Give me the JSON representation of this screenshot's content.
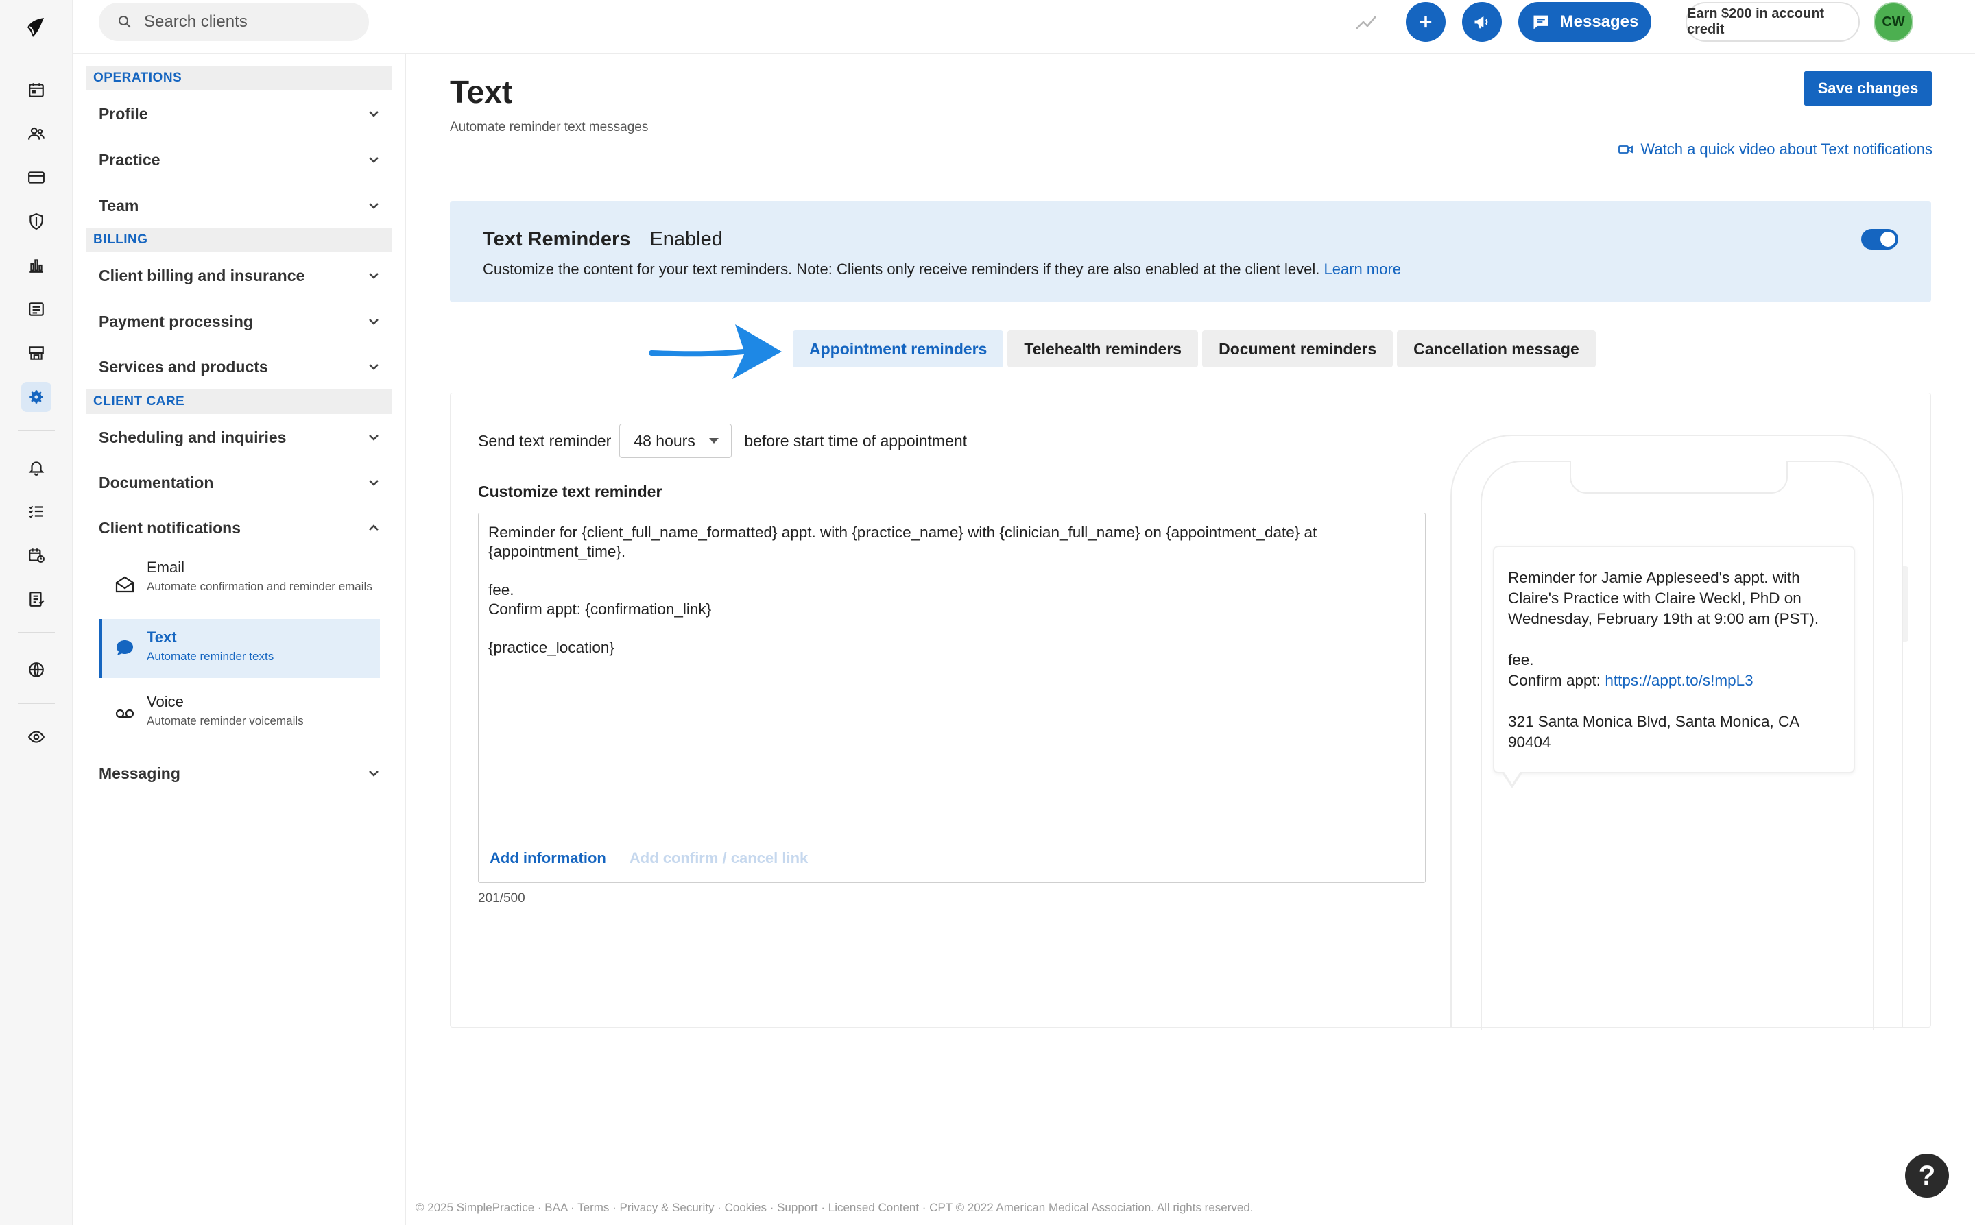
{
  "search": {
    "placeholder": "Search clients"
  },
  "topbar": {
    "messages_label": "Messages",
    "earn_label": "Earn $200 in account credit",
    "avatar_initials": "CW"
  },
  "sidebar": {
    "sections": [
      {
        "header": "OPERATIONS",
        "items": [
          "Profile",
          "Practice",
          "Team"
        ]
      },
      {
        "header": "BILLING",
        "items": [
          "Client billing and insurance",
          "Payment processing",
          "Services and products"
        ]
      },
      {
        "header": "CLIENT CARE",
        "items": [
          "Scheduling and inquiries",
          "Documentation",
          "Client notifications"
        ]
      }
    ],
    "notifications_sub": [
      {
        "title": "Email",
        "desc": "Automate confirmation and reminder emails"
      },
      {
        "title": "Text",
        "desc": "Automate reminder texts"
      },
      {
        "title": "Voice",
        "desc": "Automate reminder voicemails"
      }
    ],
    "messaging": "Messaging"
  },
  "main": {
    "title": "Text",
    "subtitle": "Automate reminder text messages",
    "save_label": "Save changes",
    "video_link": "Watch a quick video about Text notifications",
    "banner": {
      "title": "Text Reminders",
      "status": "Enabled",
      "desc": "Customize the content for your text reminders. Note: Clients only receive reminders if they are also enabled at the client level.",
      "learn_more": "Learn more",
      "toggle_on": true
    },
    "tabs": [
      "Appointment reminders",
      "Telehealth reminders",
      "Document reminders",
      "Cancellation message"
    ],
    "active_tab": "Appointment reminders",
    "send": {
      "prefix": "Send text reminder",
      "value": "48 hours",
      "suffix": "before start time of appointment"
    },
    "customize_label": "Customize text reminder",
    "template_text": "Reminder for {client_full_name_formatted} appt. with {practice_name} with {clinician_full_name} on {appointment_date} at\n{appointment_time}.\n\nfee.\nConfirm appt: {confirmation_link}\n\n{practice_location}",
    "add_information": "Add information",
    "add_confirm": "Add confirm / cancel link",
    "char_count": "201/500",
    "preview": {
      "line1": "Reminder for Jamie Appleseed's appt. with Claire's Practice with Claire Weckl, PhD on Wednesday, February 19th at 9:00 am (PST).",
      "line2": "fee.",
      "confirm_prefix": "Confirm appt: ",
      "confirm_link": "https://appt.to/s!mpL3",
      "location": "321 Santa Monica Blvd, Santa Monica, CA 90404"
    }
  },
  "footer": "© 2025 SimplePractice · BAA · Terms · Privacy & Security · Cookies · Support · Licensed Content · CPT © 2022 American Medical Association. All rights reserved.",
  "help_label": "?",
  "colors": {
    "accent": "#1565c0",
    "banner_bg": "#e3eef9",
    "avatar": "#4caf50"
  }
}
